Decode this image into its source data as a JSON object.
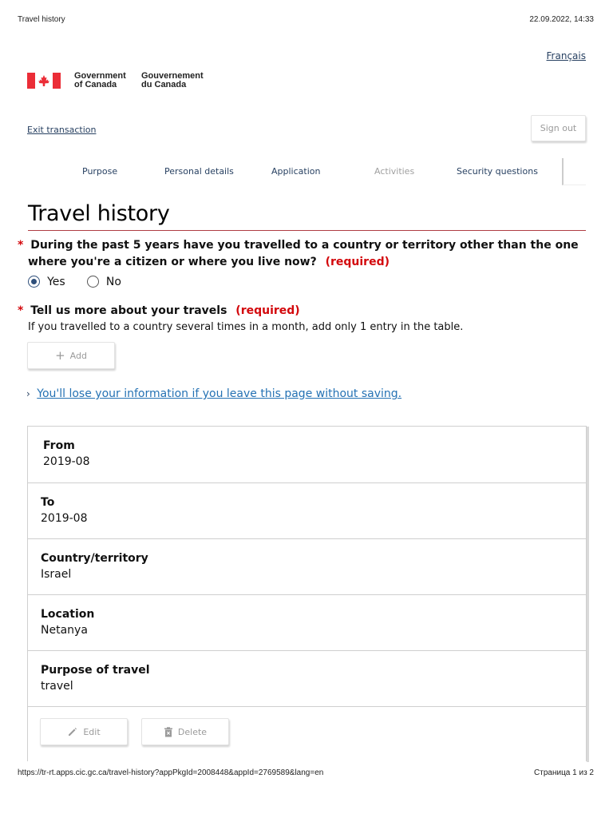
{
  "print_header": {
    "title": "Travel history",
    "timestamp": "22.09.2022, 14:33"
  },
  "print_footer": {
    "url": "https://tr-rt.apps.cic.gc.ca/travel-history?appPkgId=2008448&appId=2769589&lang=en",
    "page": "Страница 1 из 2"
  },
  "language_toggle": "Français",
  "signature": {
    "en_line1": "Government",
    "en_line2": "of Canada",
    "fr_line1": "Gouvernement",
    "fr_line2": "du Canada"
  },
  "exit_transaction": "Exit transaction",
  "sign_out": "Sign out",
  "steps": [
    {
      "label": "Purpose",
      "state": "link"
    },
    {
      "label": "Personal details",
      "state": "link"
    },
    {
      "label": "Application",
      "state": "link"
    },
    {
      "label": "Activities",
      "state": "disabled"
    },
    {
      "label": "Security questions",
      "state": "link"
    }
  ],
  "page_title": "Travel history",
  "question1": {
    "star": "*",
    "text_line1": "During the past 5 years have you travelled to a country or territory other than the one",
    "text_line2": "where you're a citizen or where you live now?",
    "required": "(required)",
    "options": [
      "Yes",
      "No"
    ],
    "selected": "Yes"
  },
  "question2": {
    "star": "*",
    "text": "Tell us more about your travels",
    "required": "(required)",
    "hint": "If you travelled to a country several times in a month, add only 1 entry in the table."
  },
  "add_button": "Add",
  "warning_link": "You'll lose your information if you leave this page without saving.",
  "travel_entry": {
    "fields": [
      {
        "label": "From",
        "value": "2019-08"
      },
      {
        "label": "To",
        "value": "2019-08"
      },
      {
        "label": "Country/territory",
        "value": "Israel"
      },
      {
        "label": "Location",
        "value": "Netanya"
      },
      {
        "label": "Purpose of travel",
        "value": "travel"
      }
    ],
    "edit_label": "Edit",
    "delete_label": "Delete"
  },
  "colors": {
    "link": "#284162",
    "required": "#d3080c",
    "rule": "#af3c43",
    "flag_red": "#eb2d37"
  }
}
